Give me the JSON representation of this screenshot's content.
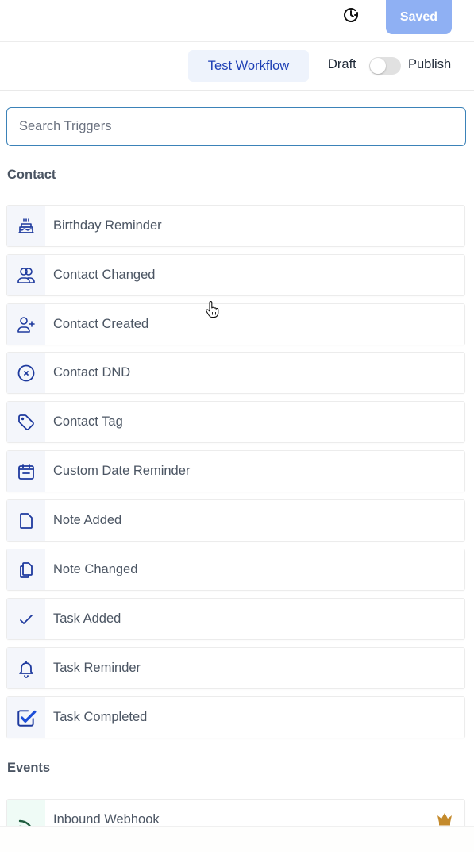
{
  "header": {
    "history_icon": "history-clock-icon",
    "saved_label": "Saved",
    "saved_color": "#8fb0f3"
  },
  "toolbar": {
    "test_workflow_label": "Test Workflow",
    "draft_label": "Draft",
    "publish_label": "Publish",
    "publish_toggle_on": false
  },
  "search": {
    "placeholder": "Search Triggers",
    "value": ""
  },
  "sections": [
    {
      "title": "Contact",
      "items": [
        {
          "label": "Birthday Reminder",
          "icon": "cake-icon"
        },
        {
          "label": "Contact Changed",
          "icon": "users-icon"
        },
        {
          "label": "Contact Created",
          "icon": "user-plus-icon"
        },
        {
          "label": "Contact DND",
          "icon": "x-circle-icon"
        },
        {
          "label": "Contact Tag",
          "icon": "tag-icon"
        },
        {
          "label": "Custom Date Reminder",
          "icon": "calendar-icon"
        },
        {
          "label": "Note Added",
          "icon": "document-icon"
        },
        {
          "label": "Note Changed",
          "icon": "documents-icon"
        },
        {
          "label": "Task Added",
          "icon": "check-icon"
        },
        {
          "label": "Task Reminder",
          "icon": "bell-icon"
        },
        {
          "label": "Task Completed",
          "icon": "check-square-icon"
        }
      ]
    },
    {
      "title": "Events",
      "items": [
        {
          "label": "Inbound Webhook",
          "icon": "rss-icon",
          "badge": "crown-icon",
          "premium": true
        }
      ]
    }
  ],
  "colors": {
    "icon_blue": "#1e3a9e",
    "webhook_green": "#1f5c3e",
    "crown_gold": "#c48a2c",
    "accent_link": "#1d3fb5"
  }
}
